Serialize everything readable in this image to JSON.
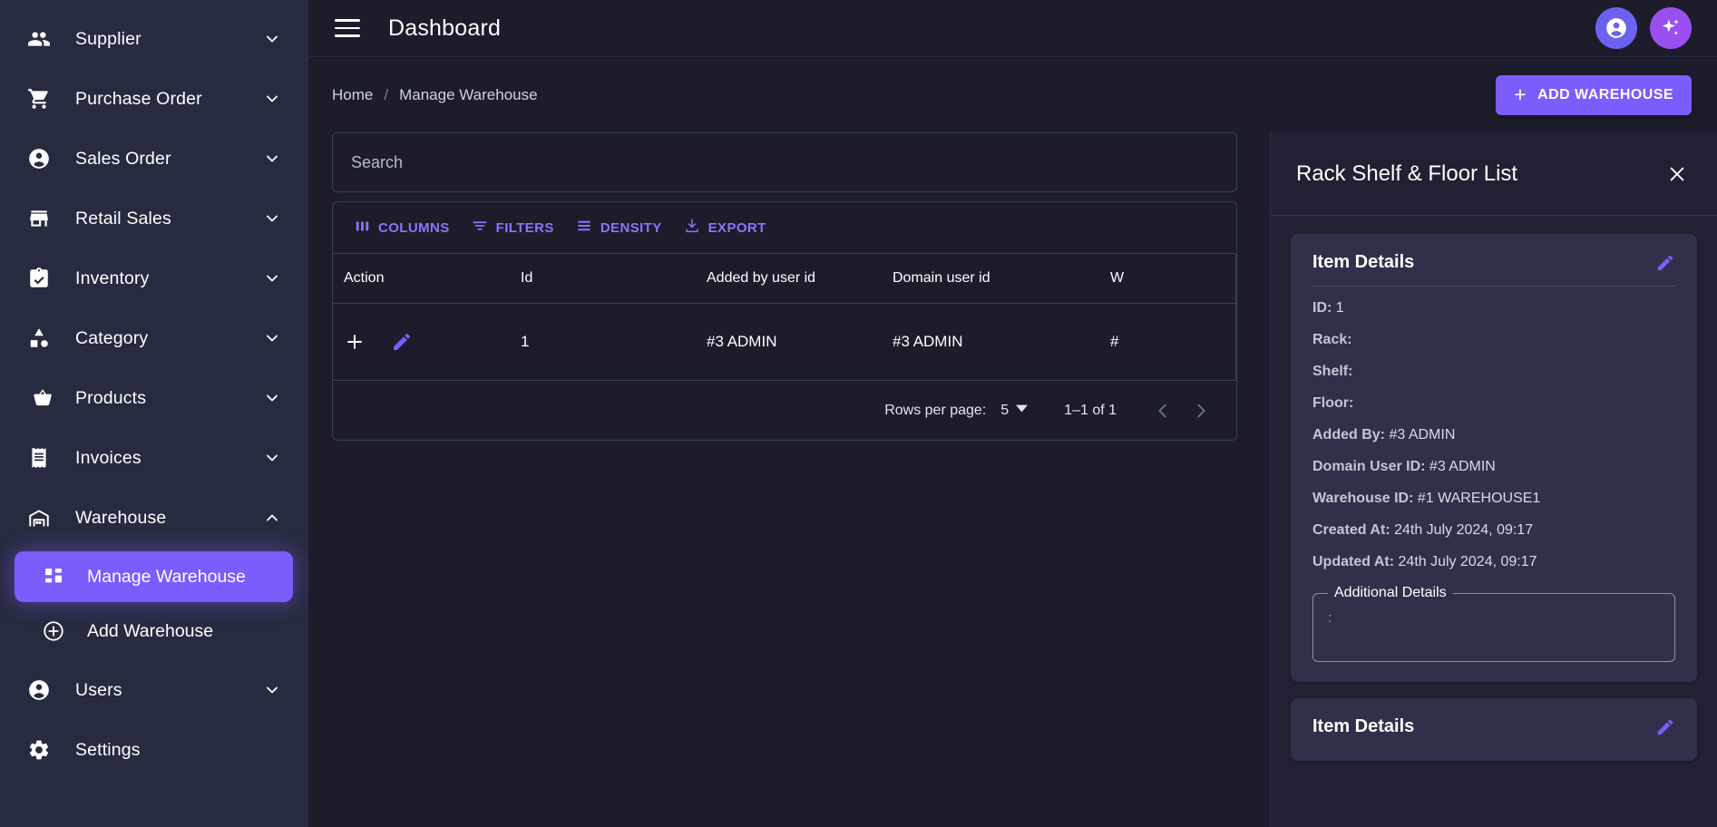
{
  "sidebar": {
    "items": [
      {
        "label": "Supplier",
        "icon": "people-icon",
        "expandable": true,
        "expanded": false
      },
      {
        "label": "Purchase Order",
        "icon": "cart-icon",
        "expandable": true,
        "expanded": false
      },
      {
        "label": "Sales Order",
        "icon": "account-icon",
        "expandable": true,
        "expanded": false
      },
      {
        "label": "Retail Sales",
        "icon": "storefront-icon",
        "expandable": true,
        "expanded": false
      },
      {
        "label": "Inventory",
        "icon": "clipboard-check-icon",
        "expandable": true,
        "expanded": false
      },
      {
        "label": "Category",
        "icon": "category-icon",
        "expandable": true,
        "expanded": false
      },
      {
        "label": "Products",
        "icon": "basket-icon",
        "expandable": true,
        "expanded": false
      },
      {
        "label": "Invoices",
        "icon": "receipt-icon",
        "expandable": true,
        "expanded": false
      },
      {
        "label": "Warehouse",
        "icon": "warehouse-icon",
        "expandable": true,
        "expanded": true
      },
      {
        "label": "Users",
        "icon": "account-icon",
        "expandable": true,
        "expanded": false
      },
      {
        "label": "Settings",
        "icon": "gear-icon",
        "expandable": false,
        "expanded": false
      }
    ],
    "warehouse_children": [
      {
        "label": "Manage Warehouse",
        "icon": "dashboard-grid-icon",
        "active": true
      },
      {
        "label": "Add Warehouse",
        "icon": "plus-circle-icon",
        "active": false
      }
    ]
  },
  "topbar": {
    "menu_icon": "hamburger-menu-icon",
    "title": "Dashboard",
    "account_icon": "account-circle-icon",
    "assistant_icon": "sparkle-icon"
  },
  "breadcrumb": {
    "home": "Home",
    "separator": "/",
    "current": "Manage Warehouse"
  },
  "actions": {
    "add_warehouse_label": "ADD WAREHOUSE",
    "add_warehouse_plus": "+"
  },
  "search": {
    "placeholder": "Search",
    "value": ""
  },
  "grid_toolbar": [
    {
      "label": "COLUMNS",
      "icon": "columns-icon"
    },
    {
      "label": "FILTERS",
      "icon": "filter-icon"
    },
    {
      "label": "DENSITY",
      "icon": "density-icon"
    },
    {
      "label": "EXPORT",
      "icon": "export-download-icon"
    }
  ],
  "table": {
    "columns": [
      {
        "key": "action",
        "label": "Action"
      },
      {
        "key": "id",
        "label": "Id"
      },
      {
        "key": "added",
        "label": "Added by user id"
      },
      {
        "key": "domain",
        "label": "Domain user id"
      },
      {
        "key": "wh",
        "label": "W"
      }
    ],
    "rows": [
      {
        "action_add_icon": "plus-icon",
        "action_edit_icon": "pencil-icon",
        "id": "1",
        "added_by_user_id": "#3 ADMIN",
        "domain_user_id": "#3 ADMIN",
        "warehouse": "#"
      }
    ]
  },
  "pagination": {
    "rows_per_page_label": "Rows per page:",
    "rows_per_page_value": "5",
    "dropdown_icon": "caret-down-icon",
    "range_label": "1–1 of 1",
    "prev_icon": "chevron-left-icon",
    "next_icon": "chevron-right-icon"
  },
  "drawer": {
    "title": "Rack Shelf & Floor List",
    "close_icon": "close-icon",
    "cards": [
      {
        "title": "Item Details",
        "edit_icon": "pencil-icon",
        "fields": [
          {
            "key": "ID:",
            "value": "1"
          },
          {
            "key": "Rack:",
            "value": ""
          },
          {
            "key": "Shelf:",
            "value": ""
          },
          {
            "key": "Floor:",
            "value": ""
          },
          {
            "key": "Added By:",
            "value": "#3 ADMIN"
          },
          {
            "key": "Domain User ID:",
            "value": "#3 ADMIN"
          },
          {
            "key": "Warehouse ID:",
            "value": "#1 WAREHOUSE1"
          },
          {
            "key": "Created At:",
            "value": "24th July 2024, 09:17"
          },
          {
            "key": "Updated At:",
            "value": "24th July 2024, 09:17"
          }
        ],
        "extra_legend": "Additional Details",
        "extra_body": ":"
      },
      {
        "title": "Item Details",
        "edit_icon": "pencil-icon",
        "fields": [],
        "extra_legend": "",
        "extra_body": ""
      }
    ]
  },
  "colors": {
    "accent": "#7c5cfa",
    "toolbar_accent": "#8a75fb",
    "sidebar_bg": "#262b40",
    "page_bg": "#1d1c2b",
    "drawer_bg": "#222133",
    "card_bg": "#31304a",
    "avatar_account": "#6b63f0",
    "avatar_assistant": "#9a4ff0"
  }
}
